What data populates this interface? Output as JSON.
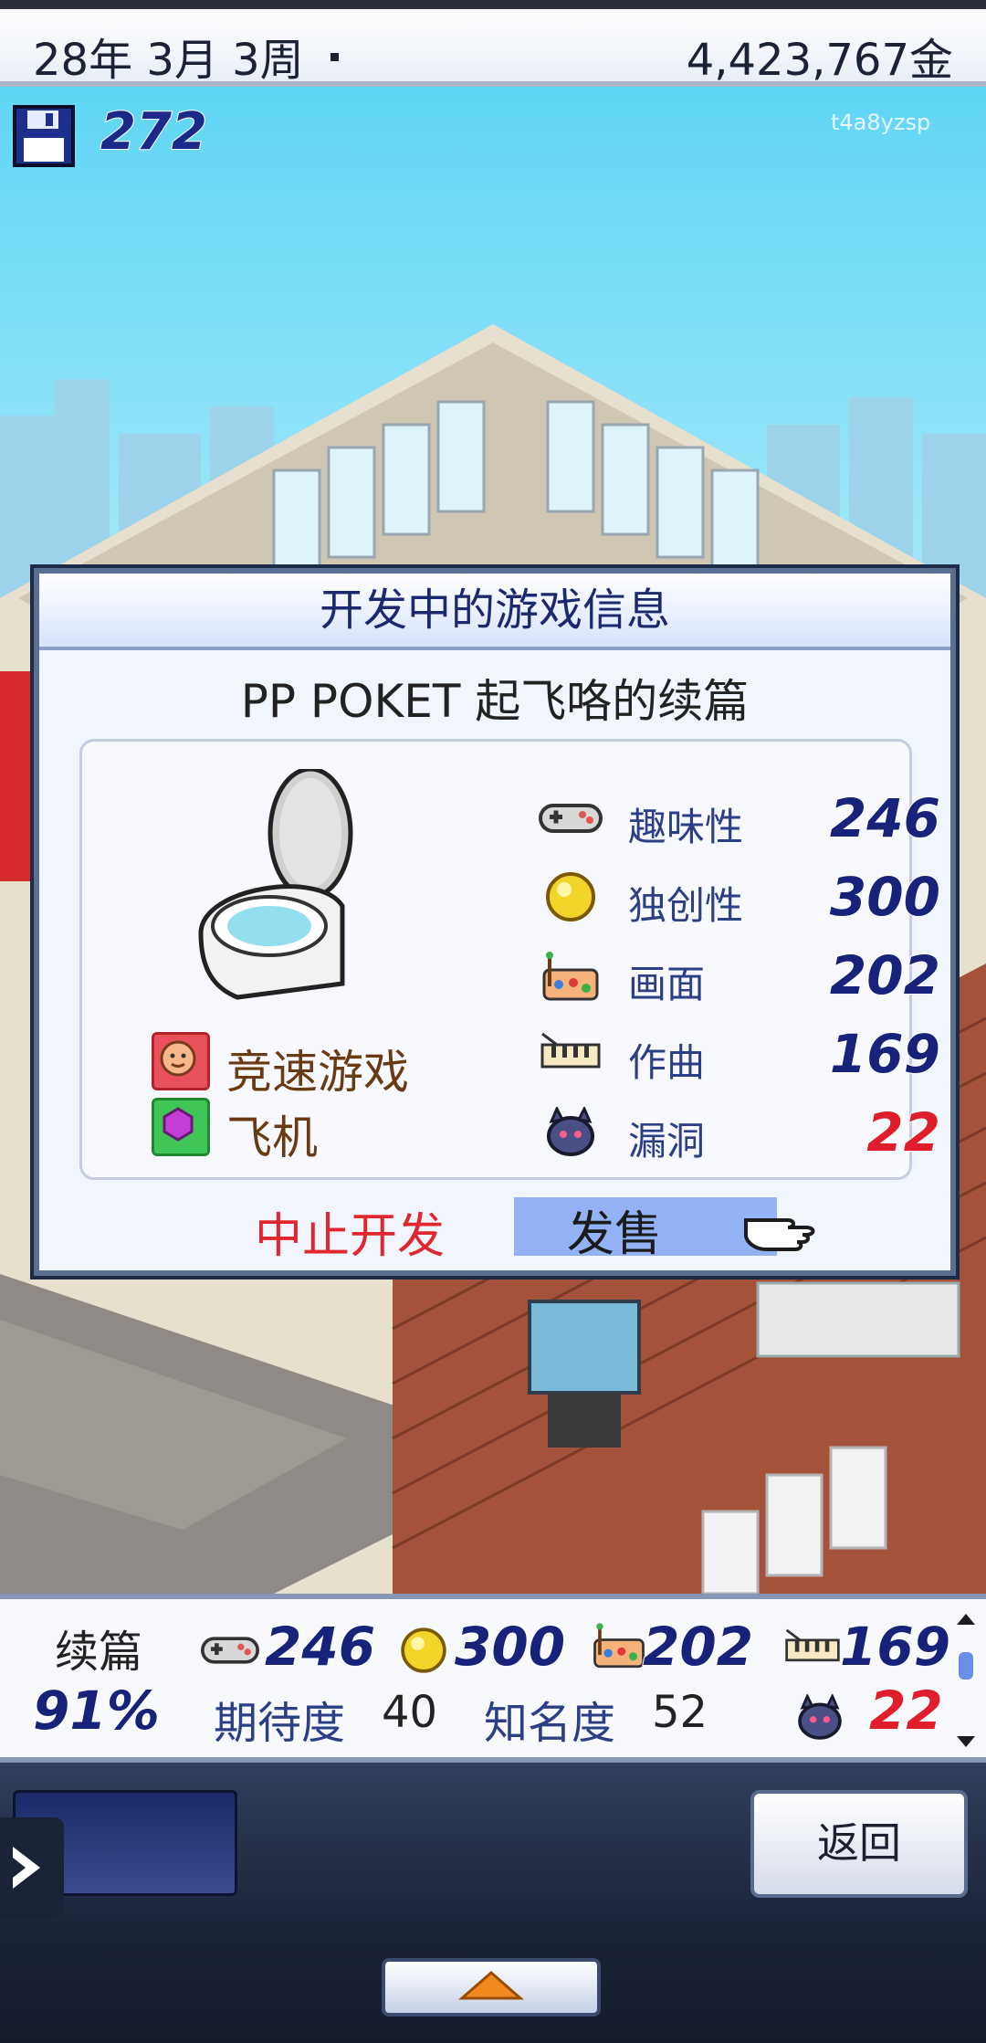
{
  "top_bar": {
    "date": "28年 3月 3周",
    "money": "4,423,767金"
  },
  "disks": {
    "count": "272",
    "icon": "floppy-disk-icon"
  },
  "watermark": "t4a8yzsp",
  "dialog": {
    "title": "开发中的游戏信息",
    "game_name": "PP POKET 起飞咯的续篇",
    "image": "toilet-icon",
    "genres": [
      {
        "label": "竞速游戏",
        "icon": "genre-face-icon",
        "color": "#e9525a"
      },
      {
        "label": "飞机",
        "icon": "theme-gem-icon",
        "color": "#3fc456"
      }
    ],
    "stats": [
      {
        "label": "趣味性",
        "value": "246",
        "icon": "gamepad-icon"
      },
      {
        "label": "独创性",
        "value": "300",
        "icon": "gold-orb-icon"
      },
      {
        "label": "画面",
        "value": "202",
        "icon": "palette-icon"
      },
      {
        "label": "作曲",
        "value": "169",
        "icon": "music-icon"
      },
      {
        "label": "漏洞",
        "value": "22",
        "icon": "bug-icon"
      }
    ],
    "stop_label": "中止开发",
    "release_label": "发售"
  },
  "info_panel": {
    "type_label": "续篇",
    "progress": "91%",
    "fun": "246",
    "creativity": "300",
    "graphics": "202",
    "music": "169",
    "bugs": "22",
    "expectation_label": "期待度",
    "expectation_value": "40",
    "fame_label": "知名度",
    "fame_value": "52"
  },
  "nav": {
    "back_label": "返回"
  },
  "colors": {
    "accent_blue": "#17237a",
    "bug_red": "#e01d2a",
    "highlight": "#92b2f5"
  }
}
